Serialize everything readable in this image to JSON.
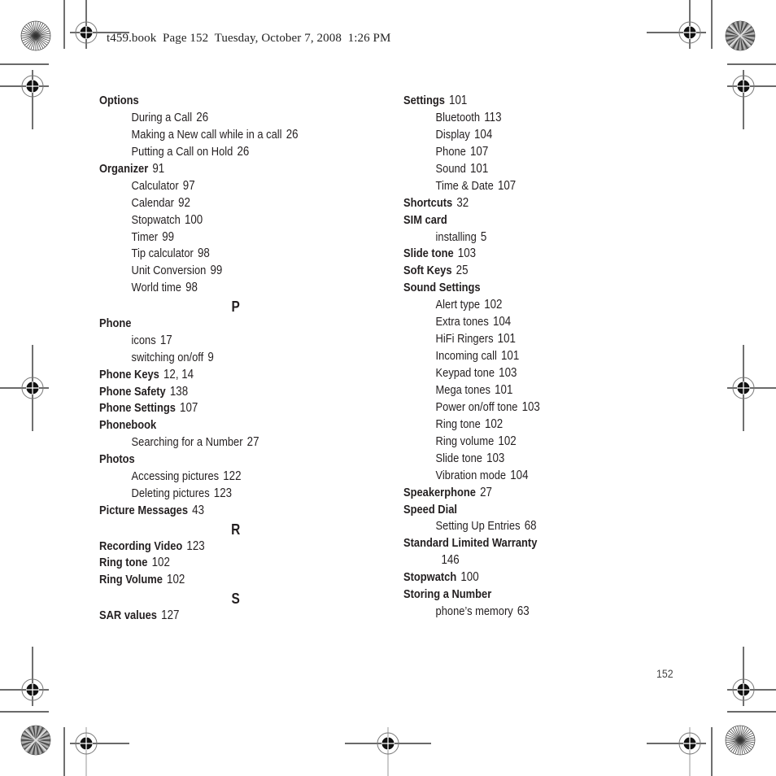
{
  "header": {
    "text": "t459.book  Page 152  Tuesday, October 7, 2008  1:26 PM"
  },
  "footer": {
    "page_number": "152"
  },
  "index": {
    "left_column": [
      {
        "type": "main",
        "term": "Options",
        "pages": ""
      },
      {
        "type": "sub",
        "term": "During a Call",
        "pages": "26"
      },
      {
        "type": "sub",
        "term": "Making a New call while in a call",
        "pages": "26"
      },
      {
        "type": "sub",
        "term": "Putting a Call on Hold",
        "pages": "26"
      },
      {
        "type": "main",
        "term": "Organizer",
        "pages": "91"
      },
      {
        "type": "sub",
        "term": "Calculator",
        "pages": "97"
      },
      {
        "type": "sub",
        "term": "Calendar",
        "pages": "92"
      },
      {
        "type": "sub",
        "term": "Stopwatch",
        "pages": "100"
      },
      {
        "type": "sub",
        "term": "Timer",
        "pages": "99"
      },
      {
        "type": "sub",
        "term": "Tip calculator",
        "pages": "98"
      },
      {
        "type": "sub",
        "term": "Unit Conversion",
        "pages": "99"
      },
      {
        "type": "sub",
        "term": "World time",
        "pages": "98"
      },
      {
        "type": "letter",
        "term": "P",
        "pages": ""
      },
      {
        "type": "main",
        "term": "Phone",
        "pages": ""
      },
      {
        "type": "sub",
        "term": "icons",
        "pages": "17"
      },
      {
        "type": "sub",
        "term": "switching on/off",
        "pages": "9"
      },
      {
        "type": "main",
        "term": "Phone Keys",
        "pages": "12, 14"
      },
      {
        "type": "main",
        "term": "Phone Safety",
        "pages": "138"
      },
      {
        "type": "main",
        "term": "Phone Settings",
        "pages": "107"
      },
      {
        "type": "main",
        "term": "Phonebook",
        "pages": ""
      },
      {
        "type": "sub",
        "term": "Searching for a Number",
        "pages": "27"
      },
      {
        "type": "main",
        "term": "Photos",
        "pages": ""
      },
      {
        "type": "sub",
        "term": "Accessing pictures",
        "pages": "122"
      },
      {
        "type": "sub",
        "term": "Deleting pictures",
        "pages": "123"
      },
      {
        "type": "main",
        "term": "Picture Messages",
        "pages": "43"
      },
      {
        "type": "letter",
        "term": "R",
        "pages": ""
      },
      {
        "type": "main",
        "term": "Recording Video",
        "pages": "123"
      },
      {
        "type": "main",
        "term": "Ring tone",
        "pages": "102"
      },
      {
        "type": "main",
        "term": "Ring Volume",
        "pages": "102"
      },
      {
        "type": "letter",
        "term": "S",
        "pages": ""
      },
      {
        "type": "main",
        "term": "SAR values",
        "pages": "127"
      }
    ],
    "right_column": [
      {
        "type": "main",
        "term": "Settings",
        "pages": "101"
      },
      {
        "type": "sub",
        "term": "Bluetooth",
        "pages": "113"
      },
      {
        "type": "sub",
        "term": "Display",
        "pages": "104"
      },
      {
        "type": "sub",
        "term": "Phone",
        "pages": "107"
      },
      {
        "type": "sub",
        "term": "Sound",
        "pages": "101"
      },
      {
        "type": "sub",
        "term": "Time & Date",
        "pages": "107"
      },
      {
        "type": "main",
        "term": "Shortcuts",
        "pages": "32"
      },
      {
        "type": "main",
        "term": "SIM card",
        "pages": ""
      },
      {
        "type": "sub",
        "term": "installing",
        "pages": "5"
      },
      {
        "type": "main",
        "term": "Slide tone",
        "pages": "103"
      },
      {
        "type": "main",
        "term": "Soft Keys",
        "pages": "25"
      },
      {
        "type": "main",
        "term": "Sound Settings",
        "pages": ""
      },
      {
        "type": "sub",
        "term": "Alert type",
        "pages": "102"
      },
      {
        "type": "sub",
        "term": "Extra tones",
        "pages": "104"
      },
      {
        "type": "sub",
        "term": "HiFi Ringers",
        "pages": "101"
      },
      {
        "type": "sub",
        "term": "Incoming call",
        "pages": "101"
      },
      {
        "type": "sub",
        "term": "Keypad tone",
        "pages": "103"
      },
      {
        "type": "sub",
        "term": "Mega tones",
        "pages": "101"
      },
      {
        "type": "sub",
        "term": "Power on/off tone",
        "pages": "103"
      },
      {
        "type": "sub",
        "term": "Ring tone",
        "pages": "102"
      },
      {
        "type": "sub",
        "term": "Ring volume",
        "pages": "102"
      },
      {
        "type": "sub",
        "term": "Slide tone",
        "pages": "103"
      },
      {
        "type": "sub",
        "term": "Vibration mode",
        "pages": "104"
      },
      {
        "type": "main",
        "term": "Speakerphone",
        "pages": "27"
      },
      {
        "type": "main",
        "term": "Speed Dial",
        "pages": ""
      },
      {
        "type": "sub",
        "term": "Setting Up Entries",
        "pages": "68"
      },
      {
        "type": "main",
        "term": "Standard Limited Warranty",
        "pages": ""
      },
      {
        "type": "cont",
        "term": "",
        "pages": "146"
      },
      {
        "type": "main",
        "term": "Stopwatch",
        "pages": "100"
      },
      {
        "type": "main",
        "term": "Storing a Number",
        "pages": ""
      },
      {
        "type": "sub",
        "term": "phone’s memory",
        "pages": "63"
      }
    ]
  }
}
